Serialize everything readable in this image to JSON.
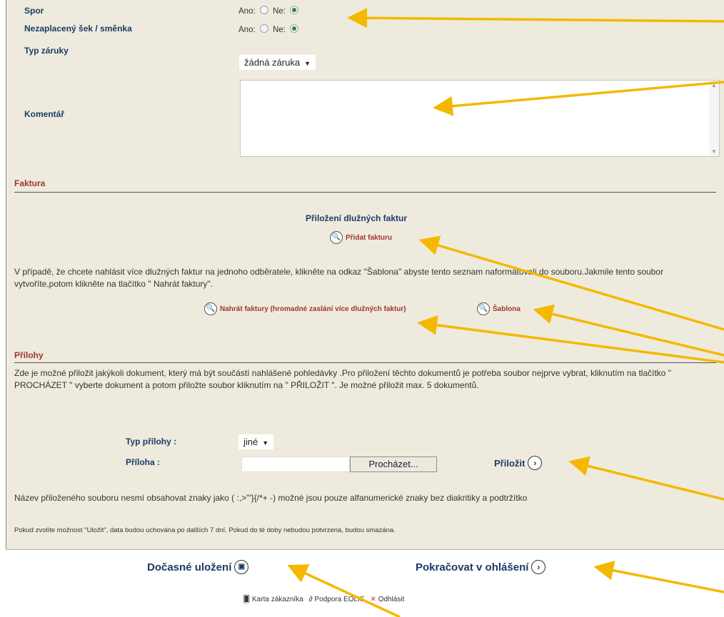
{
  "form": {
    "spor_label": "Spor",
    "spor_yes": "Ano:",
    "spor_no": "Ne:",
    "cheque_label": "Nezaplacený šek / směnka",
    "cheque_yes": "Ano:",
    "cheque_no": "Ne:",
    "guarantee_label": "Typ záruky",
    "guarantee_value": "žádná záruka",
    "comment_label": "Komentář"
  },
  "invoice": {
    "section_title": "Faktura",
    "heading": "Přiložení dlužných faktur",
    "add_invoice": "Přidat fakturu",
    "info_text": "V případě, že chcete nahlásit více dlužných faktur na jednoho odběratele, klikněte na odkaz \"Šablona\" abyste tento seznam naformátovali do souboru.Jakmile tento soubor vytvoříte,potom klikněte na tlačítko \" Nahrát faktury\".",
    "upload_invoices": "Nahrát faktury (hromadné zaslání více dlužných faktur)",
    "template": "Šablona"
  },
  "attachments": {
    "section_title": "Přílohy",
    "info_text": "Zde je možné přiložit jakýkoli dokument, který má být součástí nahlášené pohledávky .Pro přiložení těchto dokumentů je potřeba soubor nejprve vybrat, kliknutím na tlačítko \" PROCHÁZET \" vyberte dokument a potom přiložte soubor kliknutím na \" PŘILOŽIT \". Je možné přiložit max. 5 dokumentů.",
    "type_label": "Typ přílohy :",
    "type_value": "jiné",
    "file_label": "Příloha :",
    "file_value": "",
    "browse_button": "Procházet...",
    "attach_button": "Přiložit",
    "filename_note": "Název přiloženého souboru nesmí obsahovat znaky jako ( :,>\"'}{/*+ -) možné jsou pouze alfanumerické znaky bez diakritiky a podtržítko",
    "save_note": "Pokud zvolíte možnost \"Uložit\", data budou uchována po dalších 7 dní. Pokud do té doby nebudou potvrzena, budou smazána."
  },
  "actions": {
    "temp_save": "Dočasné uložení",
    "continue": "Pokračovat v ohlášení"
  },
  "footer": {
    "customer_card": "Karta zákazníka",
    "support": "Podpora EOLIS",
    "logout": "Odhlásit"
  },
  "colors": {
    "panel_bg": "#eeebde",
    "label_blue": "#1d3a66",
    "section_red": "#a0362e",
    "annotation_arrow": "#f5b800"
  }
}
